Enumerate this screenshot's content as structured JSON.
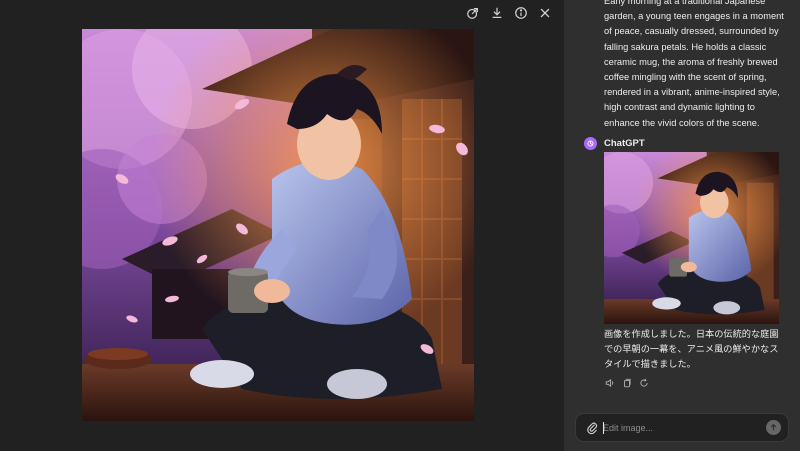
{
  "viewer": {
    "toolbar": {
      "icons": [
        "edit-selection-icon",
        "download-icon",
        "info-icon",
        "close-icon"
      ]
    },
    "image_alt": "Anime-style teen sitting cross-legged on a wooden porch holding a coffee mug, surrounded by cherry blossoms"
  },
  "panel": {
    "prompt_text": "Early morning at a traditional Japanese garden, a young teen engages in a moment of peace, casually dressed, surrounded by falling sakura petals. He holds a classic ceramic mug, the aroma of freshly brewed coffee mingling with the scent of spring, rendered in a vibrant, anime-inspired style, high contrast and dynamic lighting to enhance the vivid colors of the scene.",
    "assistant_name": "ChatGPT",
    "assistant_color": "#ab68ff",
    "reply_text": "画像を作成しました。日本の伝統的な庭園での早朝の一幕を、アニメ風の鮮やかなスタイルで描きました。",
    "action_icons": [
      "speaker-icon",
      "copy-icon",
      "regenerate-icon"
    ],
    "composer": {
      "placeholder": "Edit image..."
    }
  }
}
